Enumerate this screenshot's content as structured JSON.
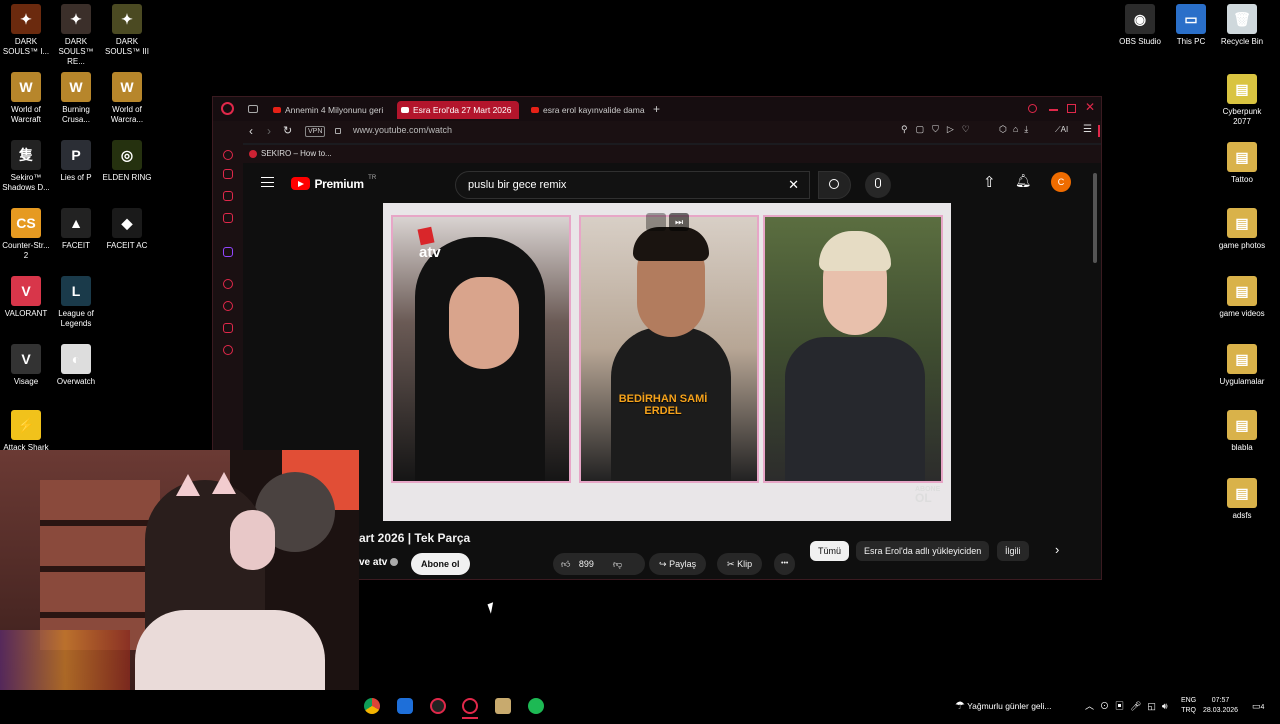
{
  "desktop_left": [
    {
      "name": "dark-souls-1",
      "label": "DARK SOULS™ I...",
      "color": "#6b2a0e",
      "glyph": "✦"
    },
    {
      "name": "dark-souls-remastered",
      "label": "DARK SOULS™ RE...",
      "color": "#3b2f2a",
      "glyph": "✦"
    },
    {
      "name": "dark-souls-3",
      "label": "DARK SOULS™ III",
      "color": "#4b4a22",
      "glyph": "✦"
    },
    {
      "name": "world-of-warcraft-1",
      "label": "World of Warcraft",
      "color": "#b7862b",
      "glyph": "W"
    },
    {
      "name": "burning-crusade",
      "label": "Burning Crusa...",
      "color": "#b7862b",
      "glyph": "W"
    },
    {
      "name": "world-of-warcraft-2",
      "label": "World of Warcra...",
      "color": "#b7862b",
      "glyph": "W"
    },
    {
      "name": "sekiro",
      "label": "Sekiro™ Shadows D...",
      "color": "#222222",
      "glyph": "隻"
    },
    {
      "name": "lies-of-p",
      "label": "Lies of P",
      "color": "#2b2e35",
      "glyph": "P"
    },
    {
      "name": "elden-ring",
      "label": "ELDEN RING",
      "color": "#25310f",
      "glyph": "◎"
    },
    {
      "name": "counter-strike",
      "label": "Counter-Str... 2",
      "color": "#e69a21",
      "glyph": "CS"
    },
    {
      "name": "faceit",
      "label": "FACEIT",
      "color": "#222222",
      "glyph": "▲"
    },
    {
      "name": "faceit-ac",
      "label": "FACEIT AC",
      "color": "#1a1a1a",
      "glyph": "◆"
    },
    {
      "name": "valorant",
      "label": "VALORANT",
      "color": "#d8364a",
      "glyph": "V"
    },
    {
      "name": "league-of-legends",
      "label": "League of Legends",
      "color": "#1a3a4a",
      "glyph": "L"
    },
    {
      "name": "visage",
      "label": "Visage",
      "color": "#333333",
      "glyph": "V"
    },
    {
      "name": "overwatch",
      "label": "Overwatch",
      "color": "#dddddd",
      "glyph": "◐"
    },
    {
      "name": "attack-shark",
      "label": "Attack Shark",
      "color": "#f1c21b",
      "glyph": "⚡"
    }
  ],
  "desktop_right": [
    {
      "name": "obs-studio",
      "label": "OBS Studio",
      "color": "#2b2b2b",
      "glyph": "◉"
    },
    {
      "name": "this-pc",
      "label": "This PC",
      "color": "#2a6fc9",
      "glyph": "▭"
    },
    {
      "name": "recycle-bin",
      "label": "Recycle Bin",
      "color": "#cfd8dc",
      "glyph": "🗑"
    },
    {
      "name": "cyberpunk",
      "label": "Cyberpunk 2077",
      "color": "#d9c441",
      "glyph": "▤"
    },
    {
      "name": "tattoo",
      "label": "Tattoo",
      "color": "#d9b24a",
      "glyph": "▤"
    },
    {
      "name": "game-photos",
      "label": "game photos",
      "color": "#d9b24a",
      "glyph": "▤"
    },
    {
      "name": "game-videos",
      "label": "game videos",
      "color": "#d9b24a",
      "glyph": "▤"
    },
    {
      "name": "uygulamalar",
      "label": "Uygulamalar",
      "color": "#d9b24a",
      "glyph": "▤"
    },
    {
      "name": "blabla",
      "label": "blabla",
      "color": "#d9b24a",
      "glyph": "▤"
    },
    {
      "name": "adsfs",
      "label": "adsfs",
      "color": "#d9b24a",
      "glyph": "▤"
    }
  ],
  "browser": {
    "tabs": [
      {
        "label": "Annemin 4 Milyonunu geri"
      },
      {
        "label": "Esra Erol'da 27 Mart 2026"
      },
      {
        "label": "esra erol kayınvalide dama"
      }
    ],
    "vpn": "VPN",
    "url": "www.youtube.com/watch",
    "ai_label": "AI",
    "bookmark": "SEKIRO – How to..."
  },
  "youtube": {
    "logo": "Premium",
    "logo_region": "TR",
    "search_value": "puslu bir gece remix",
    "avatar_letter": "C",
    "video": {
      "channel_badge": "atv",
      "name_overlay_1": "BEDİRHAN SAMİ",
      "name_overlay_2": "ERDEL",
      "watermark_1": "ABONE",
      "watermark_2": "OL"
    },
    "title": "art 2026 | Tek Parça",
    "channel": "ve atv",
    "subscribe": "Abone ol",
    "likes": "899",
    "share": "Paylaş",
    "clip": "Klip",
    "more": "•••",
    "chips": [
      "Tümü",
      "Esra Erol'da adlı yükleyiciden",
      "İlgili"
    ]
  },
  "taskbar": {
    "weather": "Yağmurlu günler geli...",
    "lang_1": "ENG",
    "lang_2": "TRQ",
    "time": "07:57",
    "date": "28.03.2026",
    "notifications": "4"
  },
  "colors": {
    "accent": "#e0284a",
    "youtube_red": "#ff0000",
    "active_tab": "#b3152c"
  }
}
